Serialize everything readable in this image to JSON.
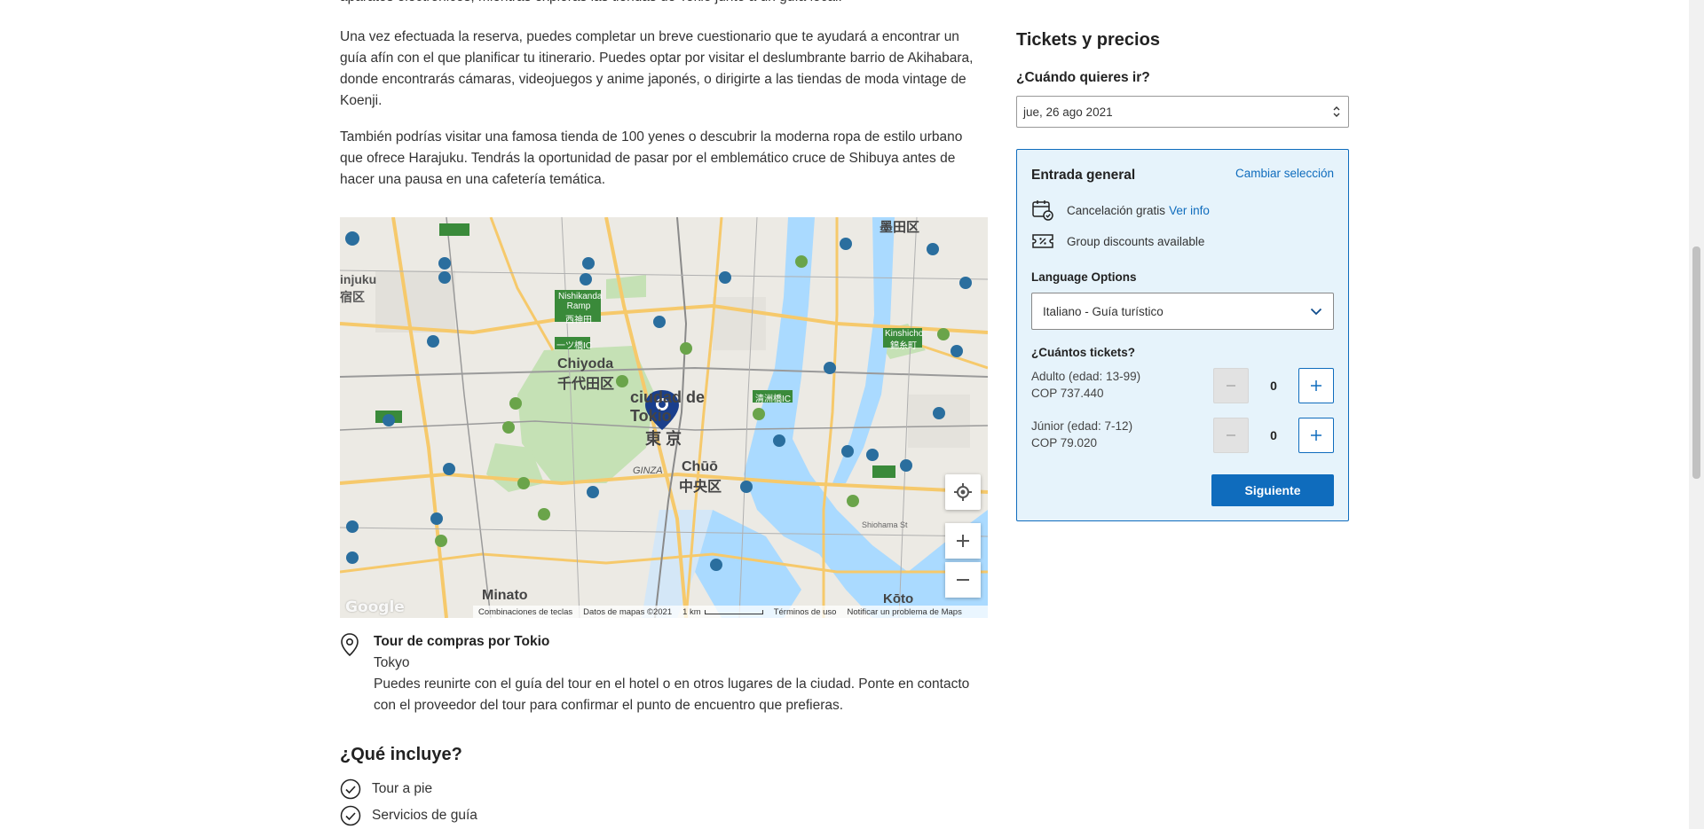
{
  "intro": {
    "p1": "aparatos electrónicos, mientras exploras las tiendas de Tokio junto a un guía local.",
    "p2": "Una vez efectuada la reserva, puedes completar un breve cuestionario que te ayudará a encontrar un guía afín con el que planificar tu itinerario. Puedes optar por visitar el deslumbrante barrio de Akihabara, donde encontrarás cámaras, videojuegos y anime japonés, o dirigirte a las tiendas de moda vintage de Koenji.",
    "p3": "También podrías visitar una famosa tienda de 100 yenes o descubrir la moderna ropa de estilo urbano que ofrece Harajuku. Tendrás la oportunidad de pasar por el emblemático cruce de Shibuya antes de hacer una pausa en una cafetería temática."
  },
  "map": {
    "labels": {
      "shinjuku": "injuku",
      "shinjuku_jp": "宿区",
      "chiyoda": "Chiyoda",
      "chiyoda_jp": "千代田区",
      "ciudad": "ciudad de Tokio",
      "tokyo_jp": "東 京",
      "chuo": "Chūō",
      "chuo_jp": "中央区",
      "minato": "Minato",
      "koto": "Kōto",
      "sumida": "墨田区",
      "ginza": "GINZA",
      "nishikanda": "Nishikanda Ramp",
      "nishikanda_jp": "西神田",
      "kinshicho": "Kinshicho",
      "kinshicho_jp": "錦糸町",
      "hitotsubashi": "一ツ橋IC",
      "kiyosubashi": "清洲橋IC",
      "shiohama": "Shiohama St"
    },
    "footer": {
      "keys": "Combinaciones de teclas",
      "data": "Datos de mapas ©2021",
      "scale": "1 km",
      "terms": "Términos de uso",
      "report": "Notificar un problema de Maps"
    },
    "logo": "Google"
  },
  "meeting": {
    "title": "Tour de compras por Tokio",
    "city": "Tokyo",
    "desc": "Puedes reunirte con el guía del tour en el hotel o en otros lugares de la ciudad. Ponte en contacto con el proveedor del tour para confirmar el punto de encuentro que prefieras."
  },
  "includes": {
    "heading": "¿Qué incluye?",
    "items": [
      "Tour a pie",
      "Servicios de guía"
    ]
  },
  "booking": {
    "title": "Tickets y precios",
    "when_label": "¿Cuándo quieres ir?",
    "date_value": "jue, 26 ago 2021",
    "entry_title": "Entrada general",
    "change_label": "Cambiar selección",
    "cancel_text": "Cancelación gratis",
    "cancel_link": "Ver info",
    "group_text": "Group discounts available",
    "lang_label": "Language Options",
    "lang_value": "Italiano - Guía turístico",
    "count_label": "¿Cuántos tickets?",
    "tickets": [
      {
        "name": "Adulto (edad: 13-99)",
        "price": "COP 737.440",
        "count": "0"
      },
      {
        "name": "Júnior (edad: 7-12)",
        "price": "COP 79.020",
        "count": "0"
      }
    ],
    "next_label": "Siguiente"
  },
  "colors": {
    "accent": "#0f6cbd",
    "box_bg": "#e6f3fb"
  }
}
